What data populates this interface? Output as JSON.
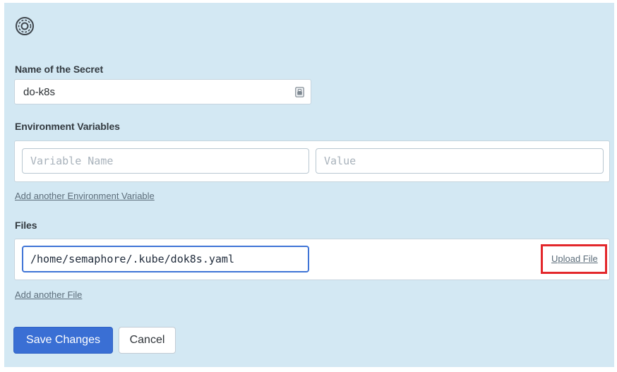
{
  "icons": {
    "header": "settings-cog-icon",
    "name_field": "keychain-icon"
  },
  "secret_name": {
    "label": "Name of the Secret",
    "value": "do-k8s"
  },
  "env_vars": {
    "label": "Environment Variables",
    "name_placeholder": "Variable Name",
    "value_placeholder": "Value",
    "add_link": "Add another Environment Variable"
  },
  "files": {
    "label": "Files",
    "path_value": "/home/semaphore/.kube/dok8s.yaml",
    "upload_link": "Upload File",
    "add_link": "Add another File"
  },
  "actions": {
    "save_label": "Save Changes",
    "cancel_label": "Cancel"
  },
  "colors": {
    "panel_background": "#d3e8f3",
    "primary_button": "#3a6fd4",
    "focus_border": "#3f74d6",
    "highlight_box": "#e3272b",
    "link_text": "#5c6d7a"
  }
}
